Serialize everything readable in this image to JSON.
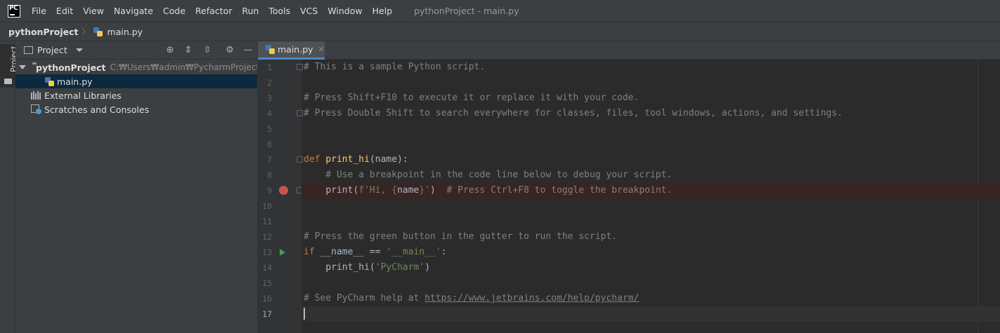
{
  "menubar": {
    "logo_text": "PC",
    "items": [
      "File",
      "Edit",
      "View",
      "Navigate",
      "Code",
      "Refactor",
      "Run",
      "Tools",
      "VCS",
      "Window",
      "Help"
    ],
    "title": "pythonProject - main.py"
  },
  "breadcrumb": {
    "project": "pythonProject",
    "file": "main.py"
  },
  "tool_strip": {
    "project_tab": "Project"
  },
  "project_panel": {
    "header_label": "Project",
    "tree": {
      "root_label": "pythonProject",
      "root_path": "C:₩Users₩admin₩PycharmProjects₩pyth",
      "file_label": "main.py",
      "libraries_label": "External Libraries",
      "scratches_label": "Scratches and Consoles"
    }
  },
  "editor": {
    "tab_label": "main.py",
    "line_numbers": [
      "1",
      "2",
      "3",
      "4",
      "5",
      "6",
      "7",
      "8",
      "9",
      "10",
      "11",
      "12",
      "13",
      "14",
      "15",
      "16",
      "17"
    ],
    "code": {
      "l1": "# This is a sample Python script.",
      "l3": "# Press Shift+F10 to execute it or replace it with your code.",
      "l4": "# Press Double Shift to search everywhere for classes, files, tool windows, actions, and settings.",
      "l7_kw": "def",
      "l7_fn": "print_hi",
      "l7_rest": "(name):",
      "l8": "# Use a breakpoint in the code line below to debug your script.",
      "l9_call": "print(",
      "l9_fstr_open": "f'Hi, {",
      "l9_var": "name",
      "l9_fstr_close": "}'",
      "l9_close": ")",
      "l9_comment": "# Press Ctrl+F8 to toggle the breakpoint.",
      "l12": "# Press the green button in the gutter to run the script.",
      "l13_kw": "if",
      "l13_mid": " __name__ == ",
      "l13_str": "'__main__'",
      "l13_end": ":",
      "l14_call": "print_hi(",
      "l14_str": "'PyCharm'",
      "l14_close": ")",
      "l16_comment": "# See PyCharm help at ",
      "l16_link": "https://www.jetbrains.com/help/pycharm/"
    }
  },
  "colors": {
    "background": "#2b2b2b",
    "panel": "#3c3f41",
    "selection": "#0d293e",
    "keyword": "#cc7832",
    "function": "#ffc66d",
    "string": "#6a8759",
    "comment": "#808080",
    "breakpoint": "#c75450",
    "run": "#499c54"
  }
}
